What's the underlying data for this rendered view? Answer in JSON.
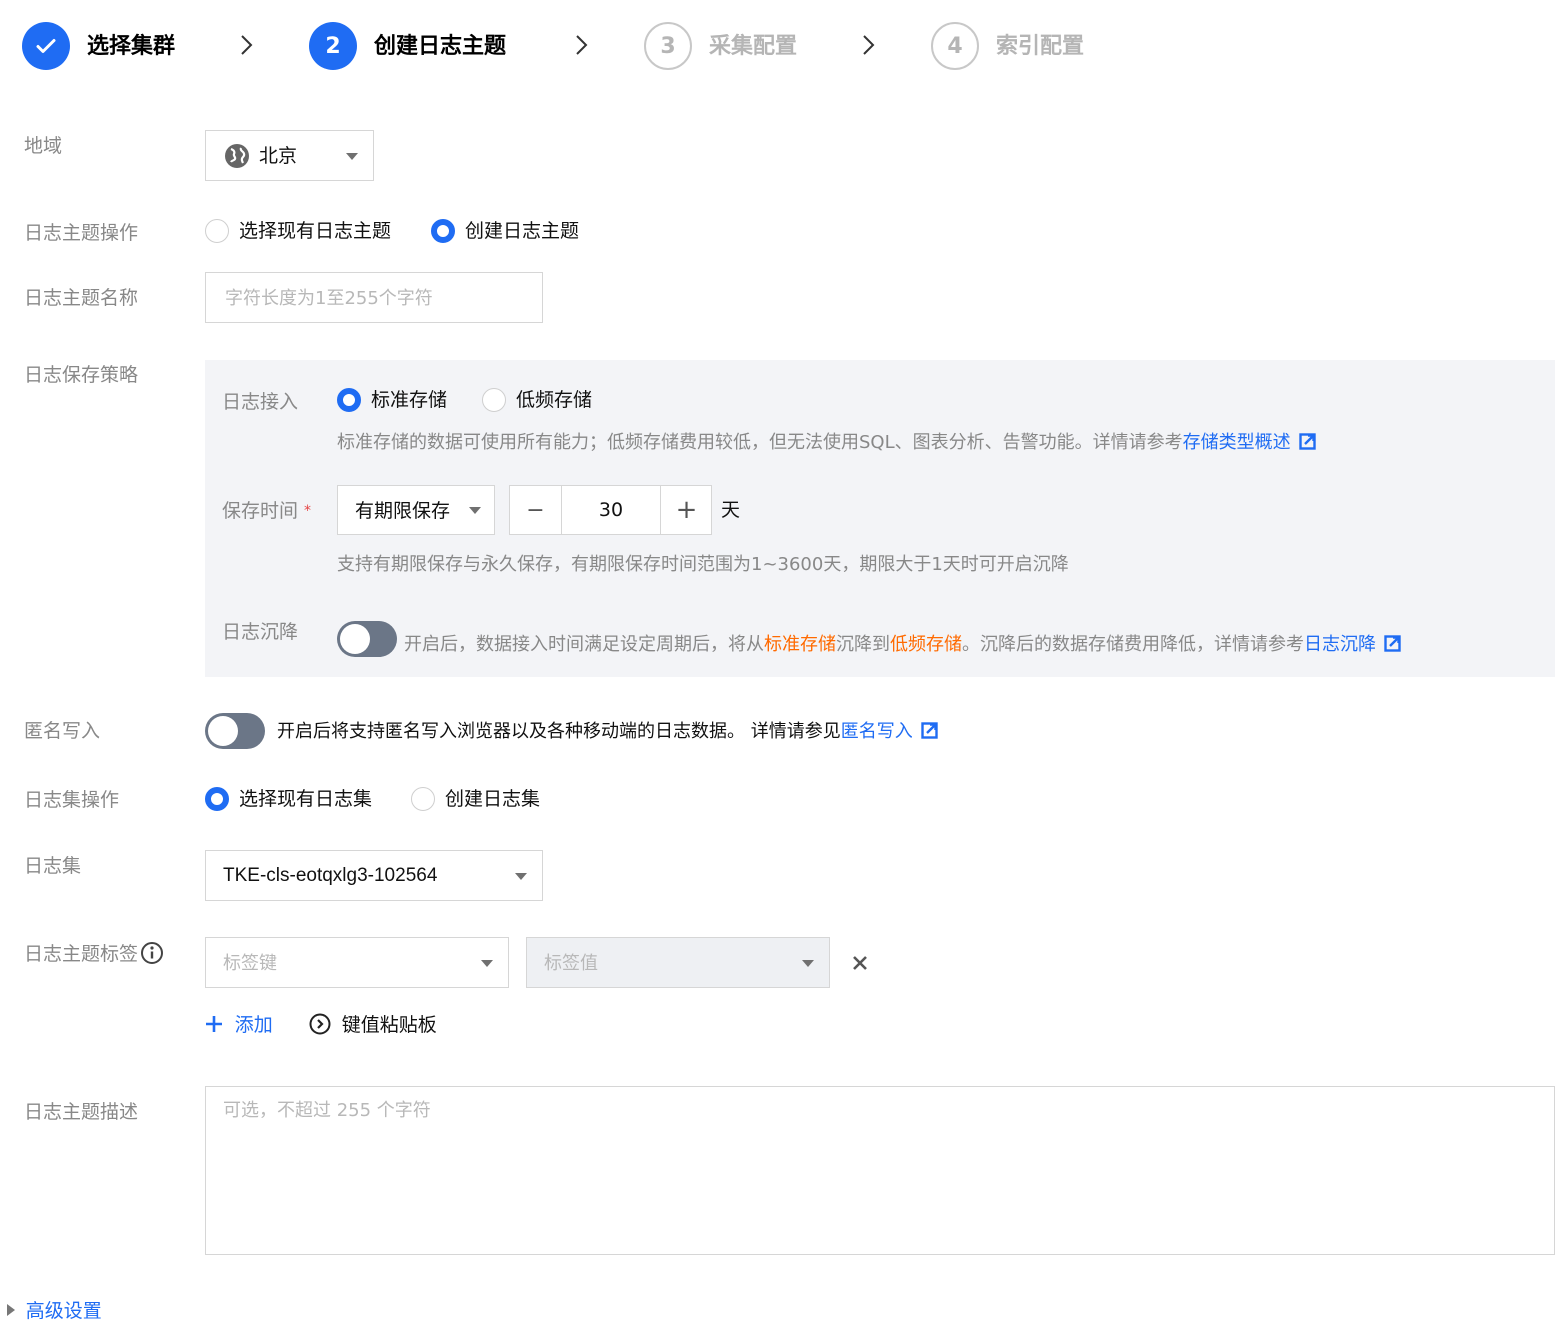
{
  "steps": [
    {
      "number": "",
      "label": "选择集群",
      "state": "done"
    },
    {
      "number": "2",
      "label": "创建日志主题",
      "state": "active"
    },
    {
      "number": "3",
      "label": "采集配置",
      "state": "todo"
    },
    {
      "number": "4",
      "label": "索引配置",
      "state": "todo"
    }
  ],
  "region": {
    "label": "地域",
    "value": "北京",
    "icon": "globe-icon"
  },
  "topic_op": {
    "label": "日志主题操作",
    "options": [
      "选择现有日志主题",
      "创建日志主题"
    ],
    "selected": "创建日志主题"
  },
  "topic_name": {
    "label": "日志主题名称",
    "placeholder": "字符长度为1至255个字符"
  },
  "retention": {
    "label": "日志保存策略",
    "ingest": {
      "label": "日志接入",
      "options": [
        "标准存储",
        "低频存储"
      ],
      "selected": "标准存储",
      "hint": "标准存储的数据可使用所有能力；低频存储费用较低，但无法使用SQL、图表分析、告警功能。详情请参考",
      "hint_link": "存储类型概述"
    },
    "time": {
      "label": "保存时间",
      "required_mark": "*",
      "mode": "有期限保存",
      "minus": "−",
      "value": "30",
      "plus": "+",
      "unit": "天",
      "hint": "支持有期限保存与永久保存，有期限保存时间范围为1~3600天，期限大于1天时可开启沉降"
    },
    "sink": {
      "label": "日志沉降",
      "enabled": false,
      "hint_a": "开启后，数据接入时间满足设定周期后，将从",
      "hint_b": "标准存储",
      "hint_c": "沉降到",
      "hint_d": "低频存储",
      "hint_e": "。沉降后的数据存储费用降低，详情请参考",
      "hint_link": "日志沉降"
    }
  },
  "anon": {
    "label": "匿名写入",
    "enabled": false,
    "hint": "开启后将支持匿名写入浏览器以及各种移动端的日志数据。 详情请参见",
    "hint_link": "匿名写入"
  },
  "set_op": {
    "label": "日志集操作",
    "options": [
      "选择现有日志集",
      "创建日志集"
    ],
    "selected": "选择现有日志集"
  },
  "logset": {
    "label": "日志集",
    "value": "TKE-cls-eotqxlg3-102564"
  },
  "tags": {
    "label": "日志主题标签",
    "key_placeholder": "标签键",
    "value_placeholder": "标签值",
    "add_label": "添加",
    "paste_label": "键值粘贴板"
  },
  "desc": {
    "label": "日志主题描述",
    "placeholder": "可选，不超过 255 个字符"
  },
  "advanced": {
    "label": "高级设置"
  },
  "colors": {
    "primary": "#1f6cf3",
    "orange": "#ff6a00",
    "muted": "#888888",
    "panel": "#f3f4f7"
  }
}
